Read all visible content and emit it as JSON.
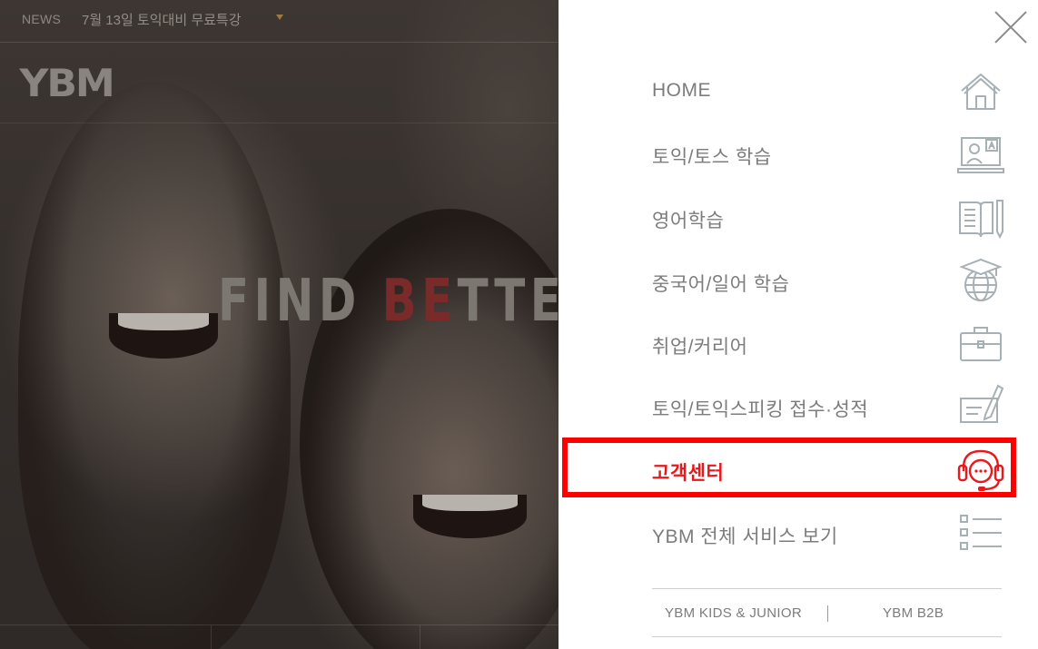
{
  "header": {
    "news_label": "NEWS",
    "news_text": "7월 13일 토익대비 무료특강"
  },
  "logo_text": "YBM",
  "hero": {
    "slogan_pre": "FIND ",
    "slogan_accent": "BE",
    "slogan_post": "TTER",
    "accent_color": "#7b2a2a"
  },
  "menu": {
    "items": [
      {
        "label": "HOME",
        "icon": "home-icon"
      },
      {
        "label": "토익/토스 학습",
        "icon": "laptop-study-icon"
      },
      {
        "label": "영어학습",
        "icon": "book-pencil-icon"
      },
      {
        "label": "중국어/일어 학습",
        "icon": "globe-graduation-icon"
      },
      {
        "label": "취업/커리어",
        "icon": "briefcase-icon"
      },
      {
        "label": "토익/토익스피킹 접수·성적",
        "icon": "document-pen-icon"
      },
      {
        "label": "고객센터",
        "icon": "headset-chat-icon",
        "active": true
      },
      {
        "label": "YBM 전체 서비스 보기",
        "icon": "list-icon"
      }
    ],
    "active_color": "#e8191c",
    "highlight_color": "#ff0000"
  },
  "footer": {
    "kids_label": "YBM KIDS & JUNIOR",
    "b2b_label": "YBM B2B"
  }
}
